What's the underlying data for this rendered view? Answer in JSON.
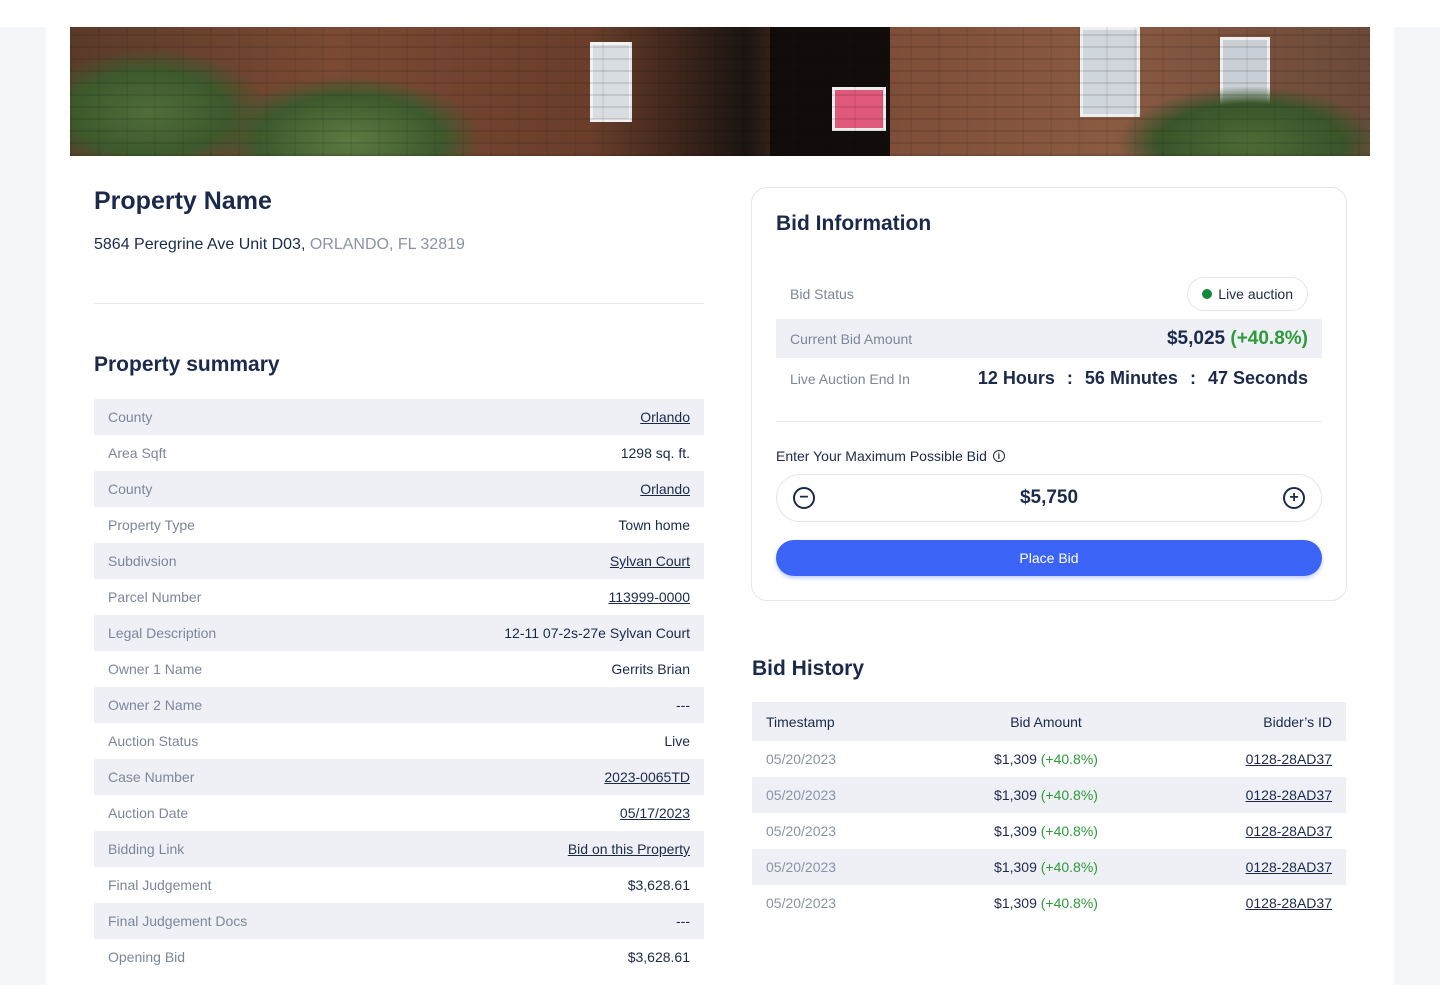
{
  "property": {
    "title": "Property Name",
    "street": "5864 Peregrine Ave Unit D03,",
    "city": "ORLANDO, FL 32819"
  },
  "summary": {
    "title": "Property summary",
    "rows": [
      {
        "label": "County",
        "value": "Orlando",
        "link": true
      },
      {
        "label": "Area Sqft",
        "value": "1298 sq. ft.",
        "link": false
      },
      {
        "label": "County",
        "value": "Orlando",
        "link": true
      },
      {
        "label": "Property Type",
        "value": "Town home",
        "link": false
      },
      {
        "label": "Subdivsion",
        "value": "Sylvan Court",
        "link": true
      },
      {
        "label": "Parcel Number",
        "value": "113999-0000",
        "link": true
      },
      {
        "label": "Legal Description",
        "value": "12-11 07-2s-27e Sylvan Court",
        "link": false
      },
      {
        "label": "Owner 1 Name",
        "value": "Gerrits Brian",
        "link": false
      },
      {
        "label": "Owner 2 Name",
        "value": "---",
        "link": false
      },
      {
        "label": "Auction Status",
        "value": "Live",
        "link": false
      },
      {
        "label": "Case Number",
        "value": "2023-0065TD",
        "link": true
      },
      {
        "label": "Auction Date",
        "value": "05/17/2023",
        "link": true
      },
      {
        "label": "Bidding Link",
        "value": "Bid on this Property",
        "link": true
      },
      {
        "label": "Final Judgement",
        "value": "$3,628.61",
        "link": false
      },
      {
        "label": "Final Judgement Docs",
        "value": "---",
        "link": false
      },
      {
        "label": "Opening Bid",
        "value": "$3,628.61",
        "link": false
      }
    ]
  },
  "bid_info": {
    "title": "Bid Information",
    "status_label": "Bid Status",
    "status_value": "Live auction",
    "current_label": "Current Bid Amount",
    "current_amount": "$5,025",
    "current_change": "(+40.8%)",
    "end_label": "Live Auction End In",
    "countdown": {
      "hours": "12 Hours",
      "minutes": "56 Minutes",
      "seconds": "47 Seconds",
      "separator": ":"
    },
    "max_bid_label": "Enter Your Maximum Possible Bid",
    "info_icon": "i",
    "minus": "−",
    "plus": "+",
    "max_bid_value": "$5,750",
    "place_bid_label": "Place Bid"
  },
  "history": {
    "title": "Bid History",
    "headers": [
      "Timestamp",
      "Bid Amount",
      "Bidder’s ID"
    ],
    "rows": [
      {
        "timestamp": "05/20/2023",
        "amount": "$1,309",
        "change": "(+40.8%)",
        "bidder": "0128-28AD37"
      },
      {
        "timestamp": "05/20/2023",
        "amount": "$1,309",
        "change": "(+40.8%)",
        "bidder": "0128-28AD37"
      },
      {
        "timestamp": "05/20/2023",
        "amount": "$1,309",
        "change": "(+40.8%)",
        "bidder": "0128-28AD37"
      },
      {
        "timestamp": "05/20/2023",
        "amount": "$1,309",
        "change": "(+40.8%)",
        "bidder": "0128-28AD37"
      },
      {
        "timestamp": "05/20/2023",
        "amount": "$1,309",
        "change": "(+40.8%)",
        "bidder": "0128-28AD37"
      }
    ]
  },
  "colors": {
    "accent": "#3b63f5",
    "positive": "#2e9b3b",
    "live_dot": "#12893a",
    "text": "#1b2a4a"
  },
  "icons": {
    "info": "info-icon",
    "minus": "minus-circle-icon",
    "plus": "plus-circle-icon",
    "status": "status-dot-icon"
  }
}
